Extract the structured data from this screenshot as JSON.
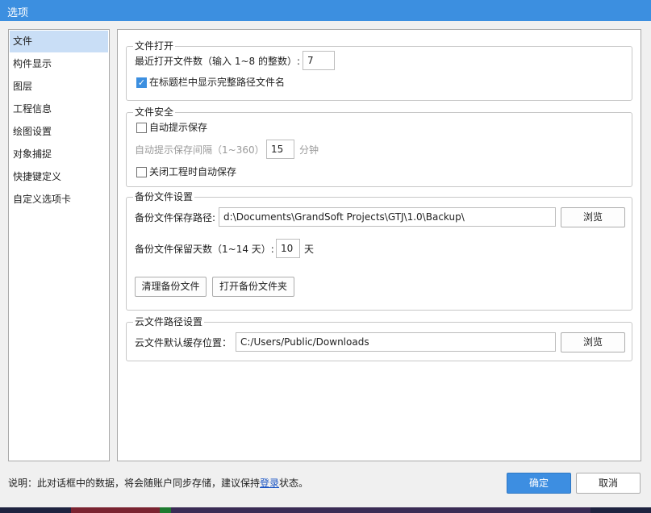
{
  "window": {
    "title": "选项"
  },
  "sidebar": {
    "items": [
      {
        "label": "文件"
      },
      {
        "label": "构件显示"
      },
      {
        "label": "图层"
      },
      {
        "label": "工程信息"
      },
      {
        "label": "绘图设置"
      },
      {
        "label": "对象捕捉"
      },
      {
        "label": "快捷键定义"
      },
      {
        "label": "自定义选项卡"
      }
    ],
    "selected_index": 0
  },
  "file_open": {
    "title": "文件打开",
    "recent_label": "最近打开文件数（输入 1~8 的整数）:",
    "recent_value": "7",
    "show_full_path_label": "在标题栏中显示完整路径文件名",
    "show_full_path_checked": true
  },
  "file_security": {
    "title": "文件安全",
    "auto_prompt_label": "自动提示保存",
    "auto_prompt_checked": false,
    "interval_label": "自动提示保存间隔（1~360）",
    "interval_value": "15",
    "interval_unit": "分钟",
    "autosave_on_close_label": "关闭工程时自动保存",
    "autosave_on_close_checked": false
  },
  "backup": {
    "title": "备份文件设置",
    "path_label": "备份文件保存路径:",
    "path_value": "d:\\Documents\\GrandSoft Projects\\GTJ\\1.0\\Backup\\",
    "browse_label": "浏览",
    "days_label": "备份文件保留天数（1~14 天）:",
    "days_value": "10",
    "days_unit": "天",
    "clean_label": "清理备份文件",
    "open_folder_label": "打开备份文件夹"
  },
  "cloud": {
    "title": "云文件路径设置",
    "cache_label": "云文件默认缓存位置：",
    "cache_value": "C:/Users/Public/Downloads",
    "browse_label": "浏览"
  },
  "footer": {
    "note_prefix": "说明：此对话框中的数据，将会随账户同步存储，建议保持",
    "login_link": "登录",
    "note_suffix": "状态。",
    "ok_label": "确定",
    "cancel_label": "取消"
  },
  "colors": {
    "accent": "#3c8fe0",
    "selection": "#c9def6"
  },
  "icons": {
    "checkbox_checked": "check-icon"
  }
}
